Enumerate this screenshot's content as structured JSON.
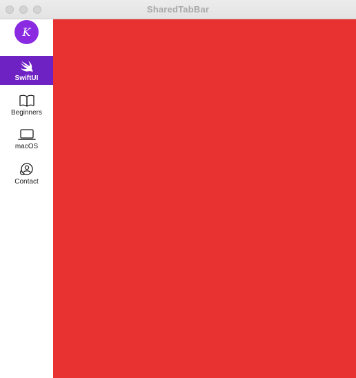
{
  "window": {
    "title": "SharedTabBar"
  },
  "sidebar": {
    "avatar": {
      "initial": "K",
      "color": "#8a2be2"
    },
    "selected_color": "#6e22c4",
    "tabs": [
      {
        "label": "SwiftUI",
        "icon": "swift-icon",
        "selected": true
      },
      {
        "label": "Beginners",
        "icon": "book-icon",
        "selected": false
      },
      {
        "label": "macOS",
        "icon": "laptop-icon",
        "selected": false
      },
      {
        "label": "Contact",
        "icon": "contact-icon",
        "selected": false
      }
    ]
  },
  "content": {
    "background_color": "#e83232"
  }
}
